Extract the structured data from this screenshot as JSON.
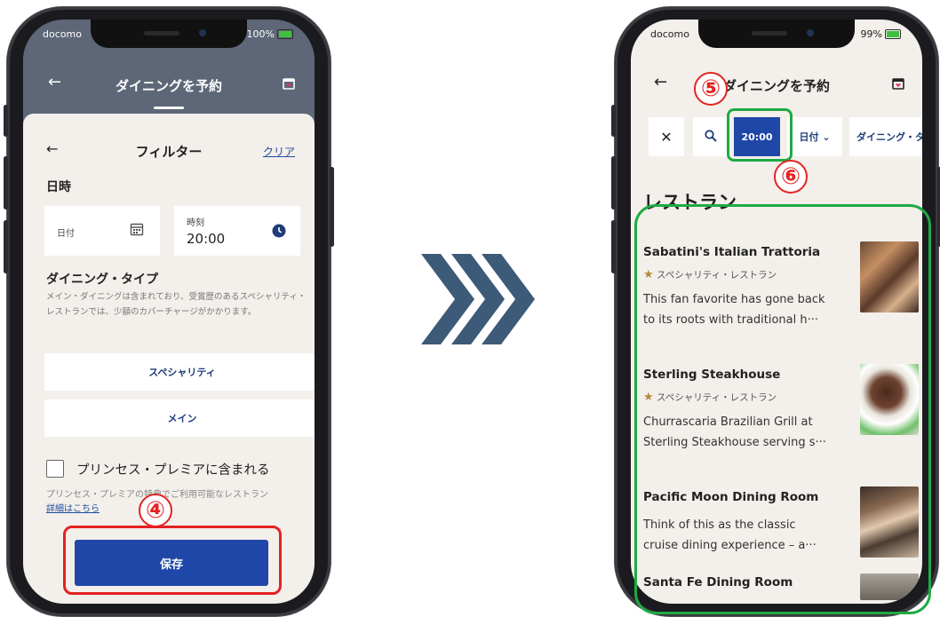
{
  "left_phone": {
    "status": {
      "carrier": "docomo",
      "battery": "100%"
    },
    "header": {
      "title": "ダイニングを予約",
      "back_icon": "arrow-left-icon",
      "calendar_icon": "calendar-heart-icon"
    },
    "filter": {
      "title": "フィルター",
      "clear_label": "クリア",
      "datetime_title": "日時",
      "date_label": "日付",
      "time_label": "時刻",
      "time_value": "20:00",
      "dining_type_title": "ダイニング・タイプ",
      "dining_type_desc": "メイン・ダイニングは含まれており、受賞歴のあるスペシャリティ・レストランでは、少額のカバーチャージがかかります。",
      "options": [
        "スペシャリティ",
        "メイン"
      ],
      "princess_label": "プリンセス・プレミアに含まれる",
      "princess_note": "プリンセス・プレミアの特典でご利用可能なレストラン",
      "details_link": "詳細はこちら",
      "save_label": "保存"
    }
  },
  "right_phone": {
    "status": {
      "carrier": "docomo",
      "battery": "99%"
    },
    "header": {
      "title": "ダイニングを予約"
    },
    "chips": {
      "time": "20:00",
      "date": "日付",
      "dining": "ダイニング・タ"
    },
    "list_title": "レストラン",
    "restaurants": [
      {
        "name": "Sabatini's Italian Trattoria",
        "type": "スペシャリティ・レストラン",
        "desc_line1": "This fan favorite has gone back",
        "desc_line2": "to its roots with traditional h···"
      },
      {
        "name": "Sterling Steakhouse",
        "type": "スペシャリティ・レストラン",
        "desc_line1": "Churrascaria Brazilian Grill at",
        "desc_line2": "Sterling Steakhouse serving s···"
      },
      {
        "name": "Pacific Moon Dining Room",
        "type": "",
        "desc_line1": "Think of this as the classic",
        "desc_line2": "cruise dining experience – a···"
      },
      {
        "name": "Santa Fe Dining Room"
      }
    ]
  },
  "annotations": {
    "step4": "④",
    "step5": "⑤",
    "step6": "⑥"
  },
  "colors": {
    "accent_blue": "#1f47a8",
    "annotation_red": "#e52222",
    "annotation_green": "#1faa44",
    "chevron": "#3d5a78"
  }
}
